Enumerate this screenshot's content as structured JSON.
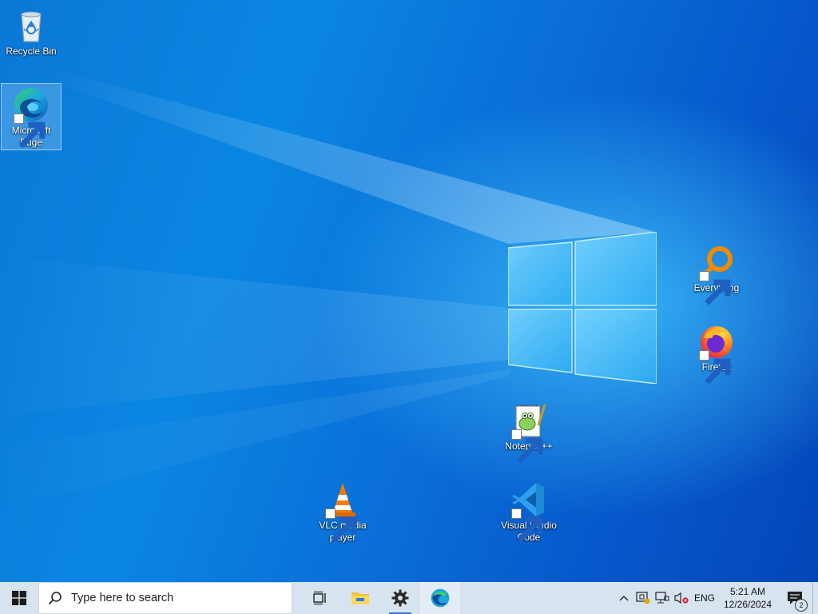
{
  "desktop": {
    "icons": [
      {
        "label": "Recycle Bin",
        "icon": "recycle-bin-icon",
        "shortcut": false
      },
      {
        "label": "Microsoft Edge",
        "icon": "edge-icon",
        "shortcut": true,
        "selected": true
      },
      {
        "label": "Everything",
        "icon": "everything-icon",
        "shortcut": true
      },
      {
        "label": "Firefox",
        "icon": "firefox-icon",
        "shortcut": true
      },
      {
        "label": "Notepad++",
        "icon": "notepadpp-icon",
        "shortcut": true
      },
      {
        "label": "VLC media player",
        "icon": "vlc-icon",
        "shortcut": true
      },
      {
        "label": "Visual Studio Code",
        "icon": "vscode-icon",
        "shortcut": true
      }
    ]
  },
  "taskbar": {
    "search_placeholder": "Type here to search",
    "pinned": [
      {
        "name": "task-view",
        "icon": "task-view-icon"
      },
      {
        "name": "file-explorer",
        "icon": "folder-icon"
      },
      {
        "name": "settings",
        "icon": "gear-icon",
        "running": true
      },
      {
        "name": "edge",
        "icon": "edge-icon",
        "active": true
      }
    ],
    "tray": {
      "language": "ENG",
      "time": "5:21 AM",
      "date": "12/26/2024",
      "notification_count": "2"
    }
  },
  "colors": {
    "desktop_blue": "#0a78d8",
    "taskbar": "#d7e4ef",
    "accent": "#3a7ccd"
  }
}
